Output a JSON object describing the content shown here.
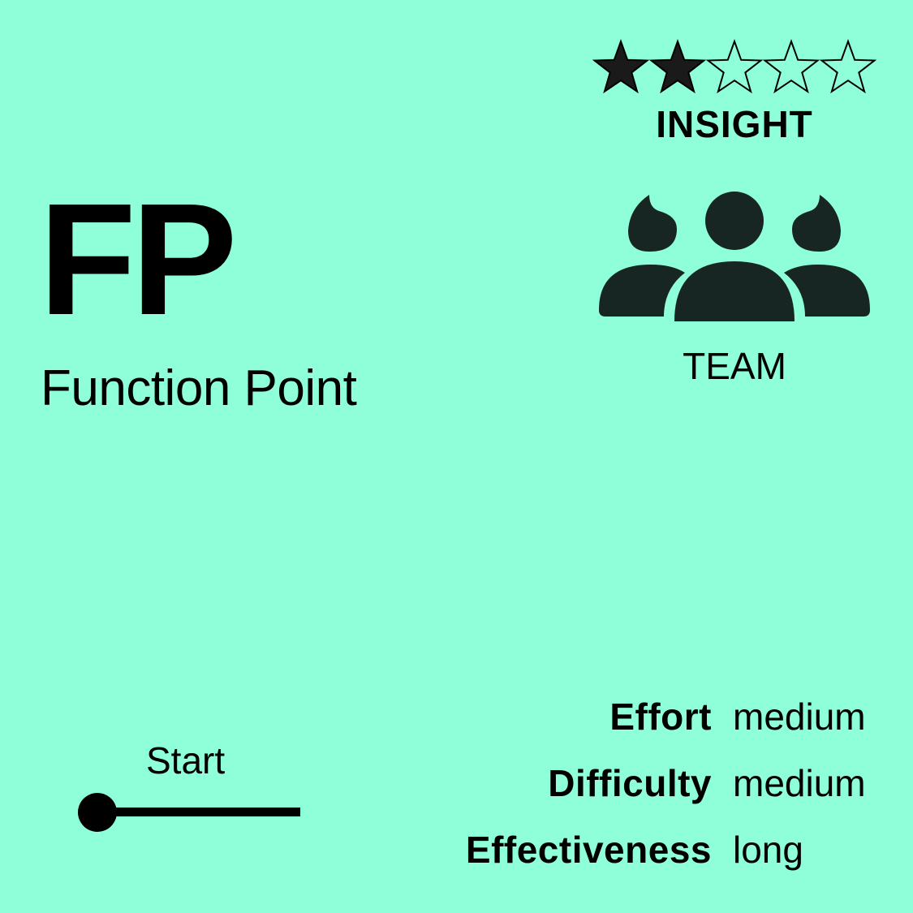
{
  "card": {
    "background_color": "#8effd8",
    "abbreviation": "FP",
    "full_name": "Function Point",
    "rating": {
      "value": 2,
      "max": 5,
      "filled_color": "#1a1a1a",
      "empty_color": "#8effd8"
    },
    "category": "INSIGHT",
    "audience": {
      "icon": "team-icon",
      "label": "TEAM",
      "icon_color": "#172622"
    },
    "stage": {
      "label": "Start",
      "position": 0
    },
    "metrics": [
      {
        "name": "Effort",
        "value": "medium"
      },
      {
        "name": "Difficulty",
        "value": "medium"
      },
      {
        "name": "Effectiveness",
        "value": "long"
      }
    ]
  }
}
